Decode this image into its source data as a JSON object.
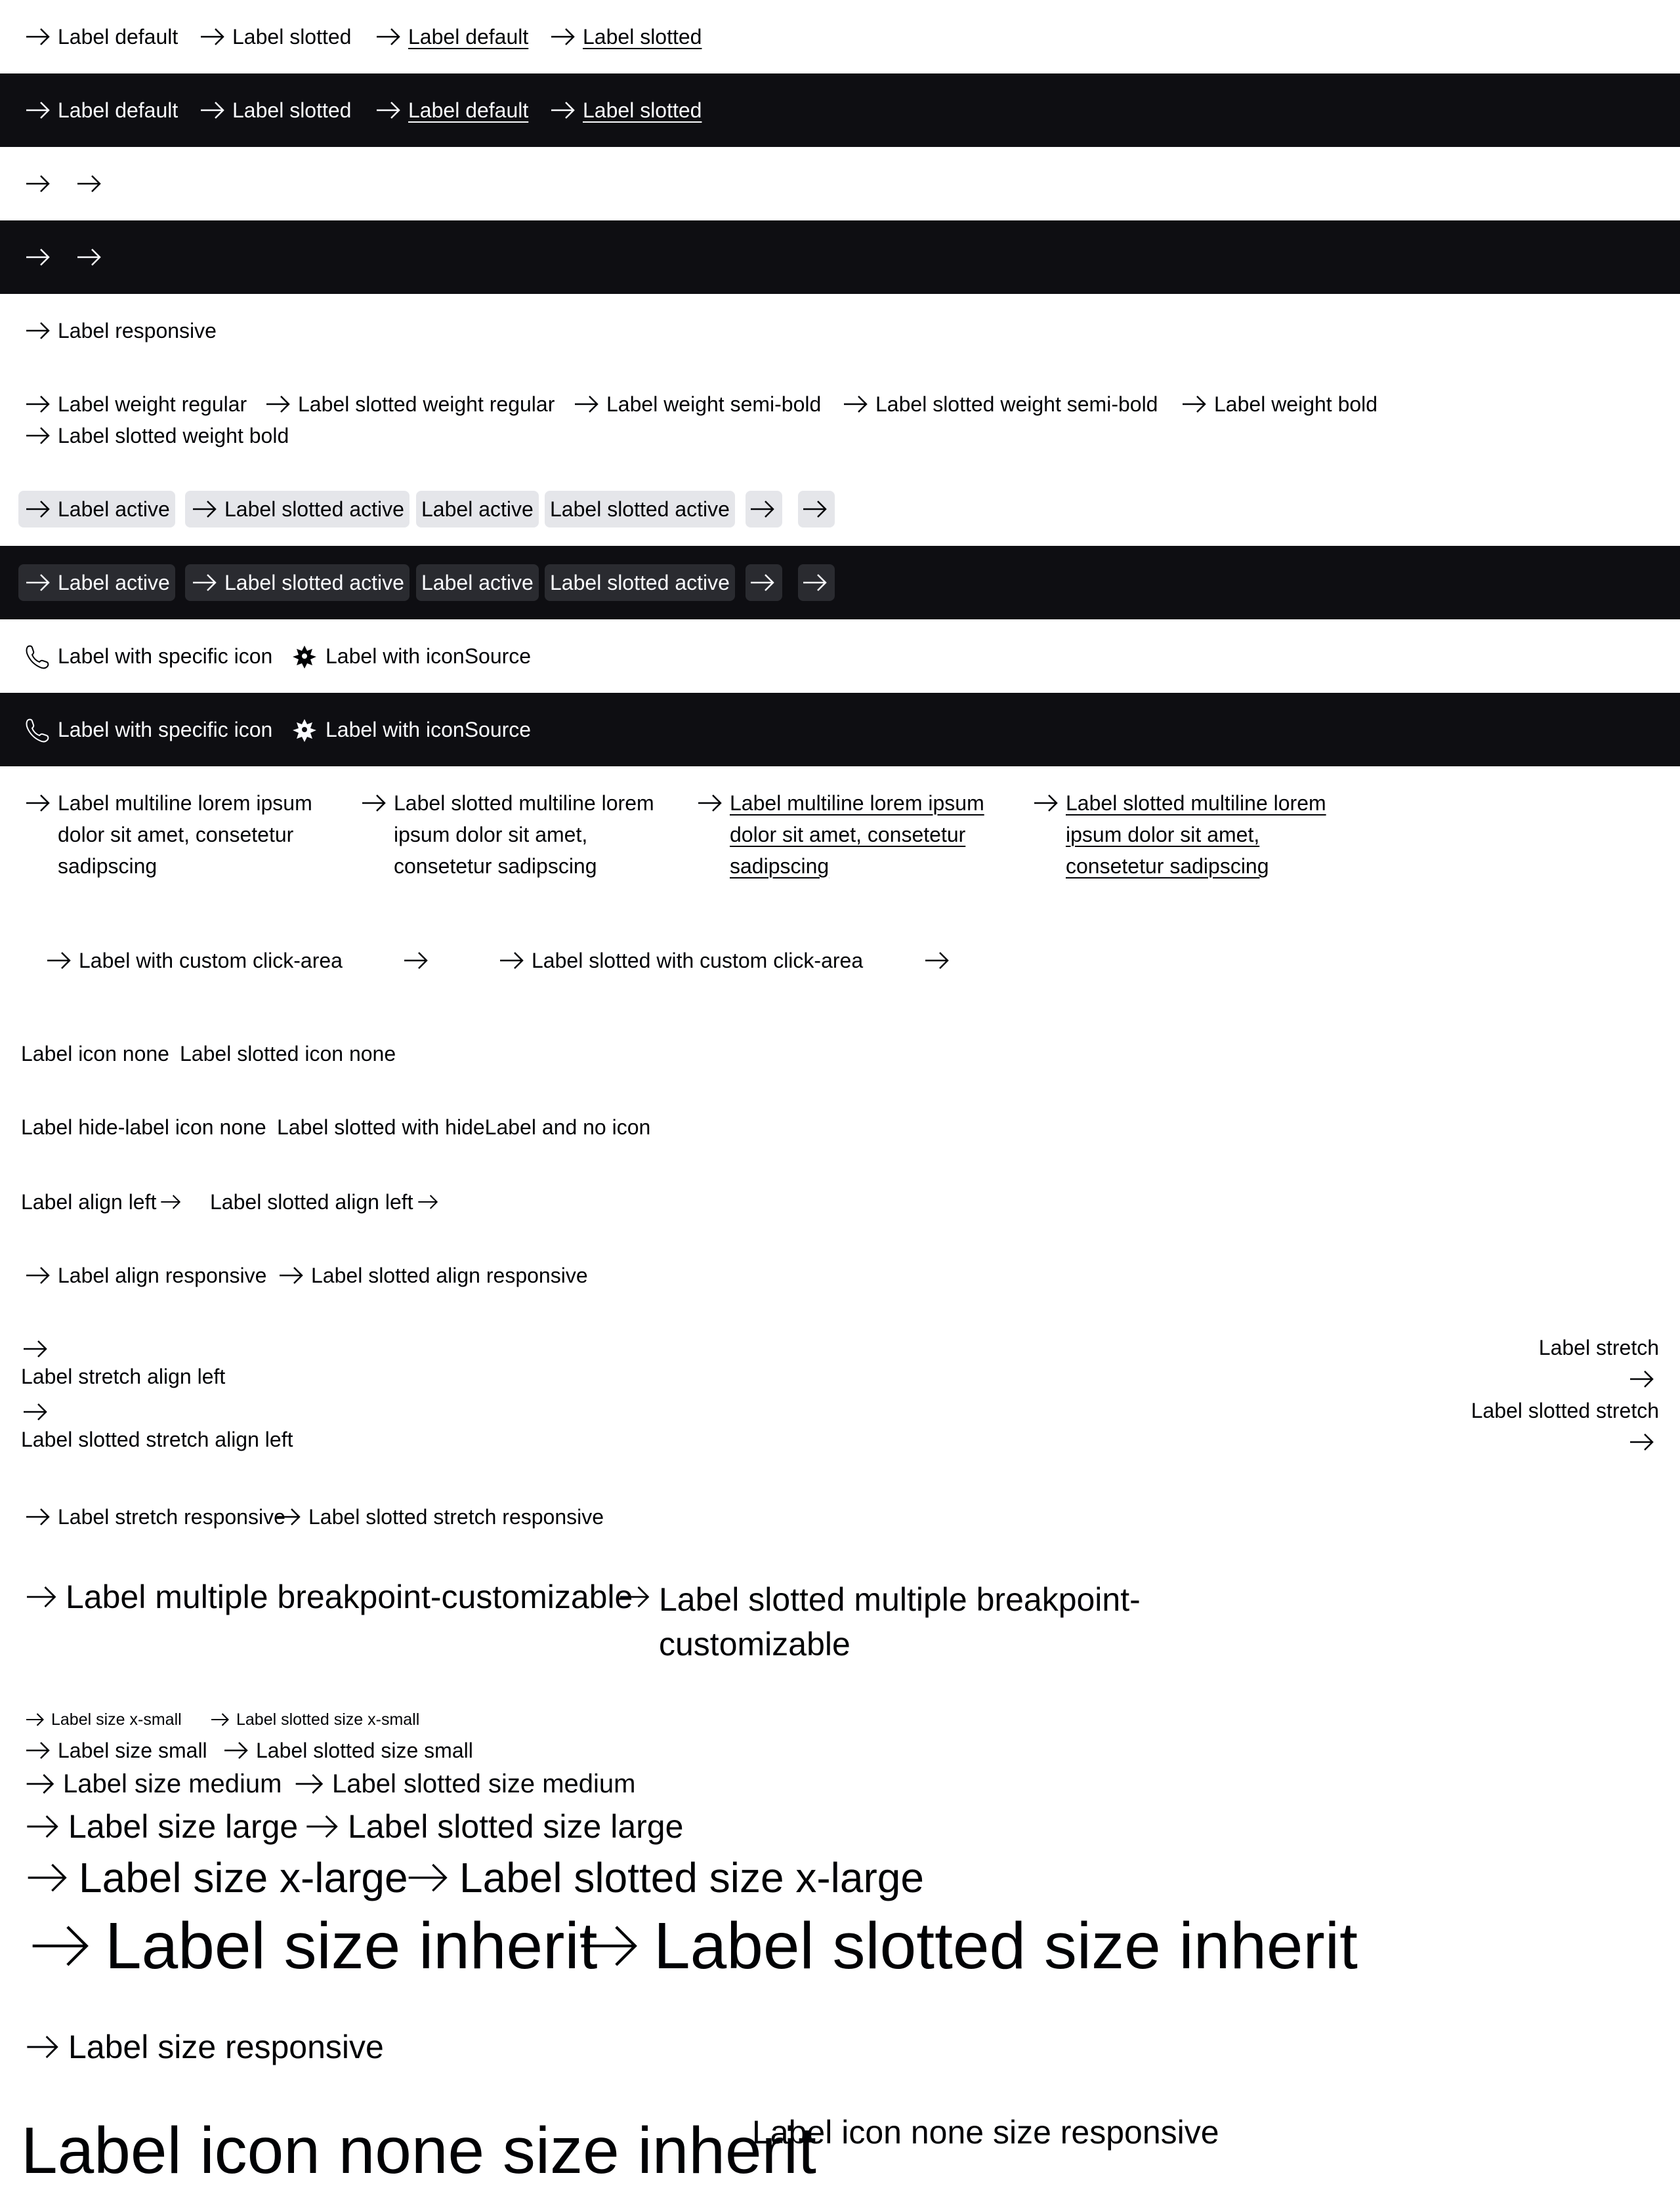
{
  "icons": {
    "arrow": "arrow-right-icon",
    "phone": "phone-icon",
    "custom": "flower-icon"
  },
  "colors": {
    "dark_bg": "#0e0e12",
    "light_text": "#fbfcff",
    "dark_text": "#010205",
    "active_light": "#e5e6ea",
    "active_dark": "#2a2b30"
  },
  "basic": {
    "default": "Label default",
    "slotted": "Label slotted"
  },
  "responsive": "Label responsive",
  "weights": {
    "regular": "Label weight regular",
    "slotted_regular": "Label slotted weight regular",
    "semibold": "Label weight semi-bold",
    "slotted_semibold": "Label slotted weight semi-bold",
    "bold": "Label weight bold",
    "slotted_bold": "Label slotted weight bold"
  },
  "active": {
    "label": "Label active",
    "slotted": "Label slotted active"
  },
  "icon_variants": {
    "specific": "Label with specific icon",
    "source": "Label with iconSource"
  },
  "multiline": {
    "label": [
      "Label multiline lorem ipsum",
      "dolor sit amet, consetetur",
      "sadipscing"
    ],
    "slotted": [
      "Label slotted multiline lorem",
      "ipsum dolor sit amet,",
      "consetetur sadipscing"
    ]
  },
  "click_area": {
    "label": "Label with custom click-area",
    "slotted": "Label slotted with custom click-area"
  },
  "icon_none": {
    "label": "Label icon none",
    "slotted": "Label slotted icon none"
  },
  "hide_label": {
    "label": "Label hide-label icon none",
    "slotted": "Label slotted with hideLabel and no icon"
  },
  "align_left": {
    "label": "Label align left",
    "slotted": "Label slotted align left"
  },
  "align_responsive": {
    "label": "Label align responsive",
    "slotted": "Label slotted align responsive"
  },
  "stretch": {
    "align_left": "Label stretch align left",
    "slotted_align_left": "Label slotted stretch align left",
    "label": "Label stretch",
    "slotted": "Label slotted stretch"
  },
  "stretch_responsive": {
    "label": "Label stretch responsive",
    "slotted": "Label slotted stretch responsive"
  },
  "breakpoint": {
    "label": "Label multiple breakpoint-customizable",
    "slotted_line1": "Label slotted multiple breakpoint-",
    "slotted_line2": "customizable"
  },
  "sizes": {
    "xsmall": "Label size x-small",
    "slotted_xsmall": "Label slotted size x-small",
    "small": "Label size small",
    "slotted_small": "Label slotted size small",
    "medium": "Label size medium",
    "slotted_medium": "Label slotted size medium",
    "large": "Label size large",
    "slotted_large": "Label slotted size large",
    "xlarge": "Label size x-large",
    "slotted_xlarge": "Label slotted size x-large",
    "inherit": "Label size inherit",
    "slotted_inherit": "Label slotted size inherit",
    "responsive": "Label size responsive"
  },
  "icon_none_sizes": {
    "inherit": "Label icon none size inherit",
    "responsive": "Label icon none size responsive"
  }
}
